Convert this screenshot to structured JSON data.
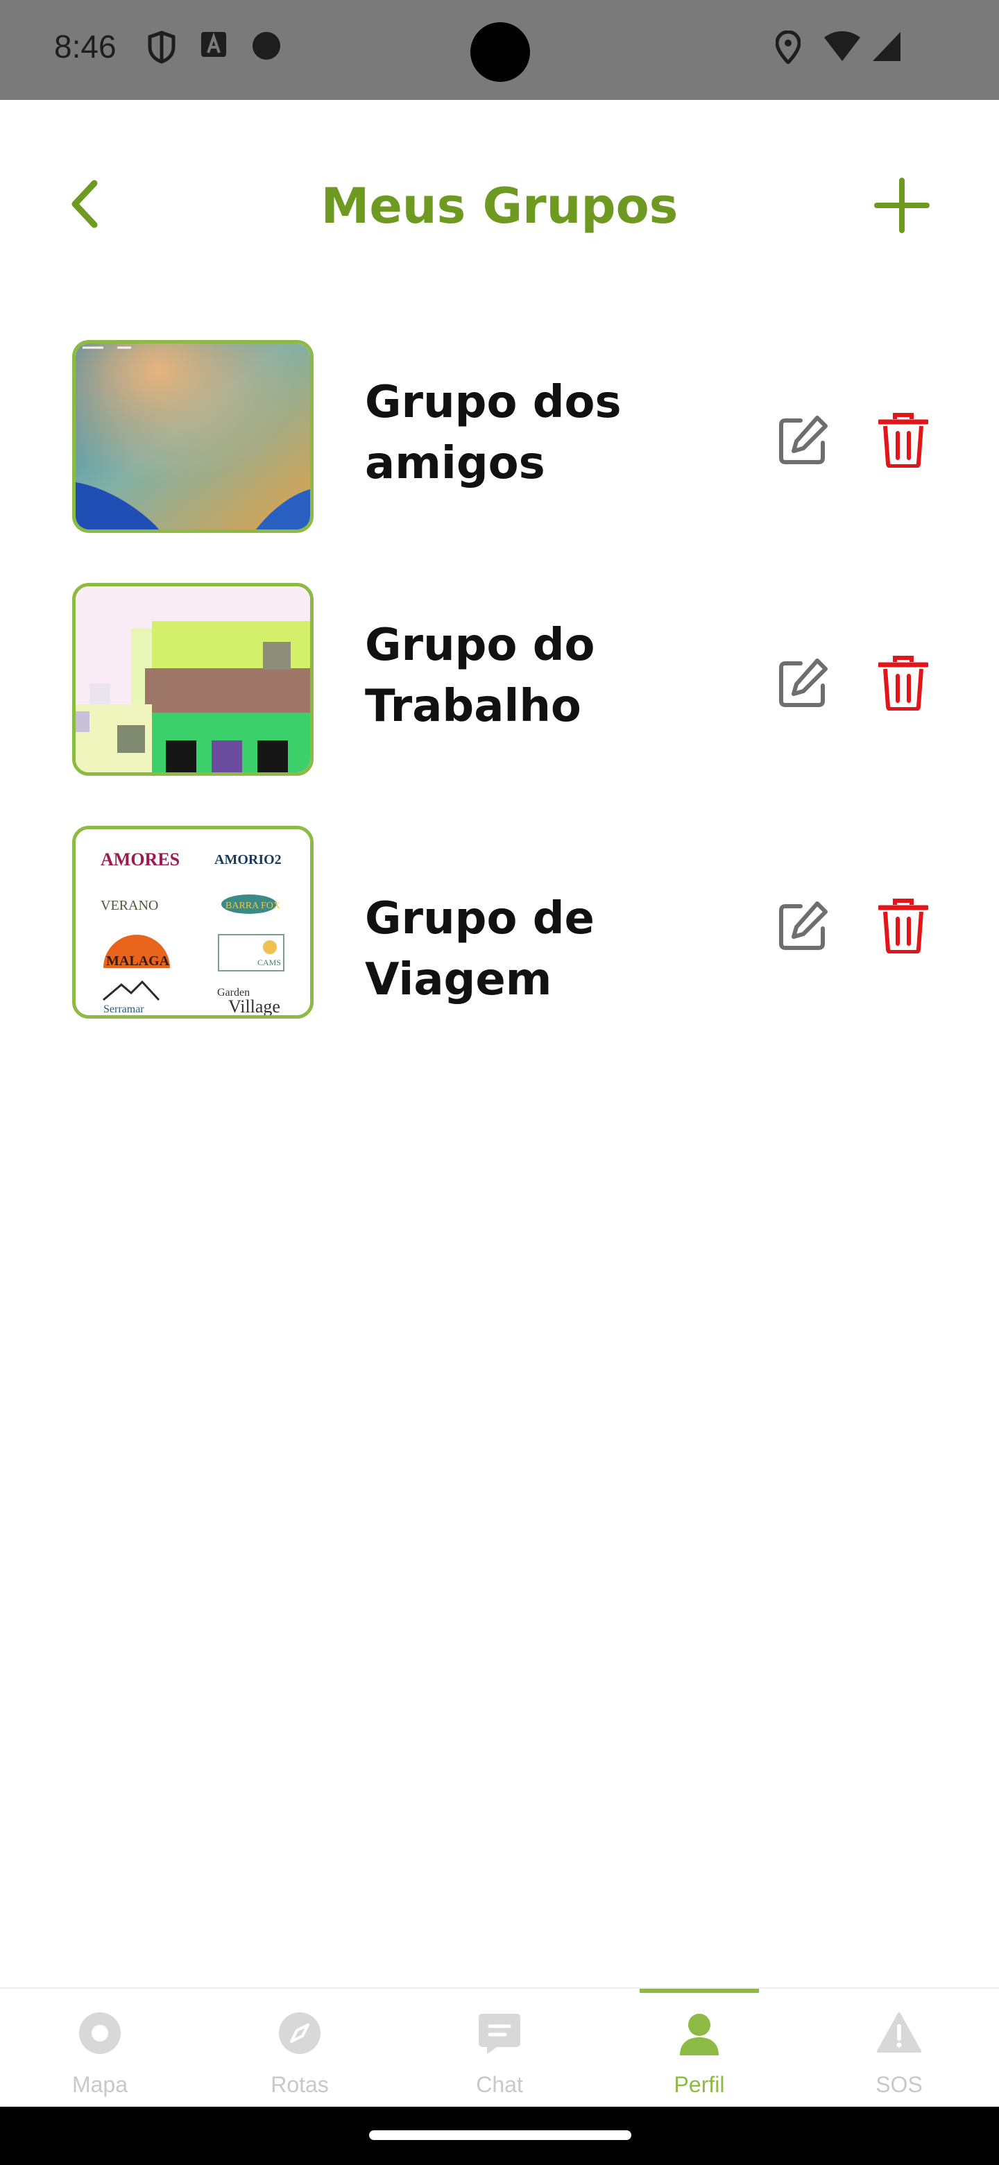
{
  "status_bar": {
    "time": "8:46",
    "left_icons": [
      "shield-icon",
      "font-a-icon",
      "dot-icon"
    ],
    "right_icons": [
      "location-icon",
      "wifi-icon",
      "signal-icon"
    ]
  },
  "header": {
    "title": "Meus Grupos",
    "back_icon": "chevron-left-icon",
    "add_icon": "plus-icon"
  },
  "groups": [
    {
      "name_line1": "Grupo dos",
      "name_line2": "amigos",
      "thumbnail": "wallpaper-image"
    },
    {
      "name_line1": "Grupo do",
      "name_line2": "Trabalho",
      "thumbnail": "pixel-art-image"
    },
    {
      "name_line1": "Grupo de Viagem",
      "name_line2": "",
      "thumbnail": "logos-collage-image",
      "thumbnail_logos": [
        "AMORES",
        "AMORIO2",
        "VERANO",
        "BARRA FOX",
        "MALAGA",
        "CAMS",
        "Serramar",
        "Garden",
        "Village"
      ]
    }
  ],
  "actions": {
    "edit_icon": "edit-icon",
    "delete_icon": "trash-icon"
  },
  "bottom_nav": {
    "items": [
      {
        "label": "Mapa",
        "icon": "map-pin-icon"
      },
      {
        "label": "Rotas",
        "icon": "compass-icon"
      },
      {
        "label": "Chat",
        "icon": "chat-icon"
      },
      {
        "label": "Perfil",
        "icon": "person-icon"
      },
      {
        "label": "SOS",
        "icon": "warning-icon"
      }
    ],
    "active_index": 3
  },
  "colors": {
    "accent": "#6f9a22",
    "accent_light": "#8cba44",
    "delete": "#e3151a",
    "icon_gray": "#6e6e6e",
    "inactive_nav": "#c8c8c8"
  }
}
